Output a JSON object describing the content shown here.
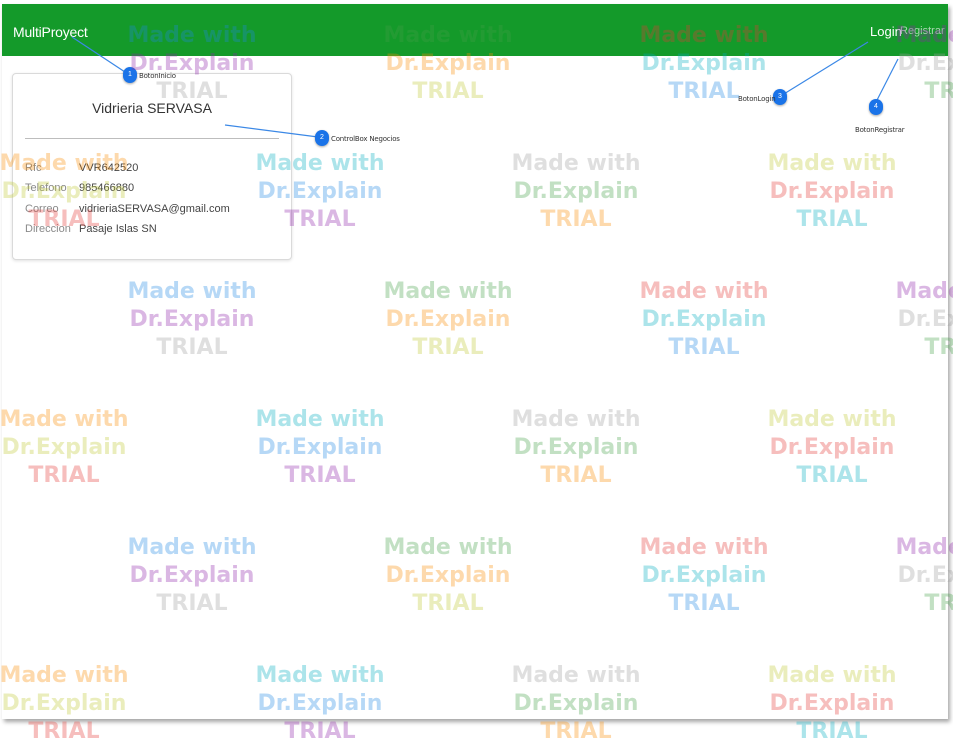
{
  "navbar": {
    "brand": "MultiProyect",
    "login_label": "Login",
    "register_label": "Registrar",
    "background_color": "#149a2a"
  },
  "business_card": {
    "title": "Vidrieria SERVASA",
    "fields": [
      {
        "label": "Rfc",
        "value": "VVR642520"
      },
      {
        "label": "Telefono",
        "value": "985466880"
      },
      {
        "label": "Correo",
        "value": "vidrieriaSERVASA@gmail.com"
      },
      {
        "label": "Direccion",
        "value": "Pasaje Islas SN"
      }
    ]
  },
  "callouts": [
    {
      "number": "1",
      "label": "BotonInicio"
    },
    {
      "number": "2",
      "label": "ControlBox Negocios"
    },
    {
      "number": "3",
      "label": "BotonLogin"
    },
    {
      "number": "4",
      "label": "BotonRegistrar"
    }
  ],
  "watermark": {
    "line1": "Made with",
    "line2": "Dr.Explain",
    "line3": "TRIAL"
  }
}
